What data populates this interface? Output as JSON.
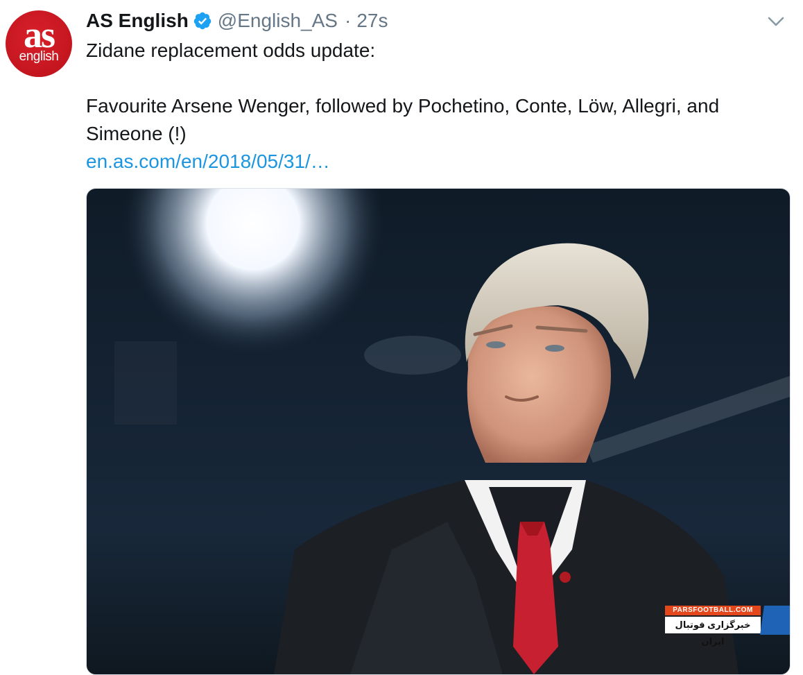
{
  "account": {
    "avatar_text_main": "as",
    "avatar_text_sub": "english",
    "name": "AS English",
    "handle": "@English_AS",
    "separator": "·",
    "time": "27s"
  },
  "tweet": {
    "line1": "Zidane replacement odds update:",
    "line2": "Favourite Arsene Wenger, followed by Pochetino, Conte, Löw, Allegri, and Simeone (!)",
    "link": "en.as.com/en/2018/05/31/…"
  },
  "watermark": {
    "site": "PARSFOOTBALL.COM",
    "tagline": "خبرگزاری فوتبال ایران"
  },
  "icons": {
    "verified": "verified-badge-icon",
    "menu": "chevron-down-icon"
  },
  "colors": {
    "brand_red": "#c4161f",
    "link": "#1b95e0",
    "verified": "#1da1f2",
    "muted": "#657786"
  }
}
